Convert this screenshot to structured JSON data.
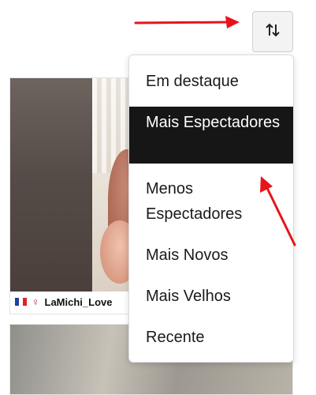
{
  "sort_menu": {
    "button_icon": "sort-arrows-icon",
    "items": [
      {
        "label": "Em destaque",
        "active": false
      },
      {
        "label": "Mais Espectadores",
        "active": true
      },
      {
        "label": "Menos Espectadores",
        "active": false
      },
      {
        "label": "Mais Novos",
        "active": false
      },
      {
        "label": "Mais Velhos",
        "active": false
      },
      {
        "label": "Recente",
        "active": false
      }
    ]
  },
  "cards": [
    {
      "username": "LaMichi_Love",
      "flag": "france-flag-icon",
      "gender_icon": "female-icon"
    },
    {
      "username": ""
    }
  ],
  "colors": {
    "annotation_arrow": "#e8141b",
    "active_item_bg": "#161616"
  }
}
